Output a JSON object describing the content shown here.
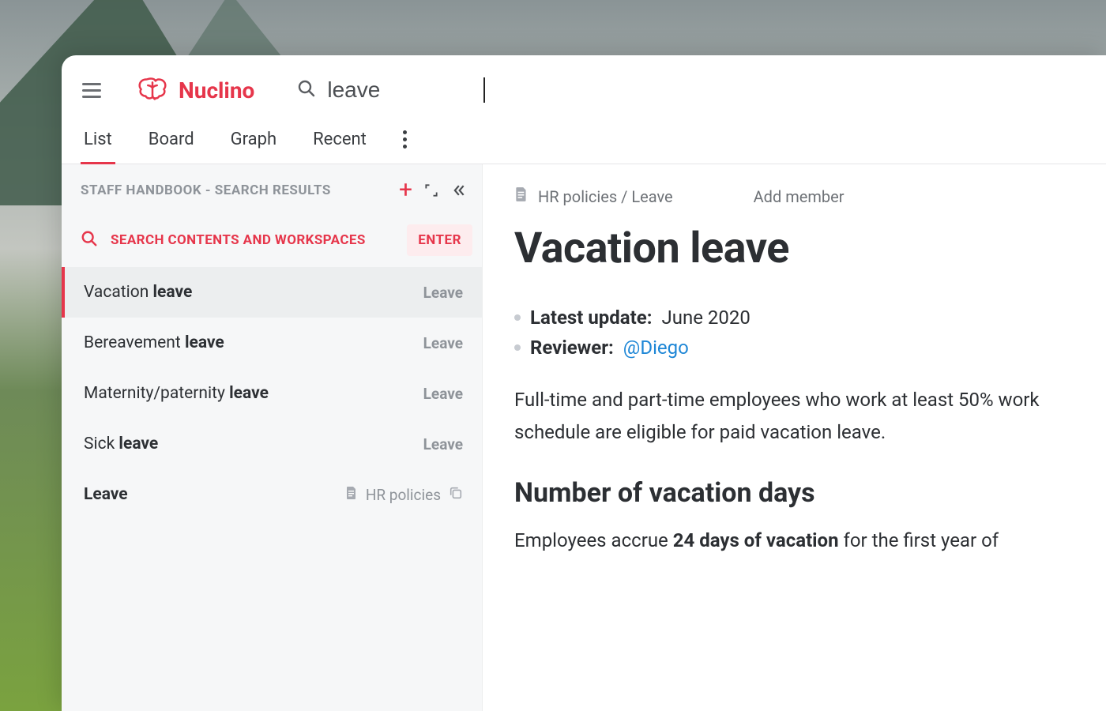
{
  "brand": {
    "name": "Nuclino"
  },
  "search": {
    "value": "leave"
  },
  "tabs": {
    "items": [
      {
        "label": "List",
        "active": true
      },
      {
        "label": "Board",
        "active": false
      },
      {
        "label": "Graph",
        "active": false
      },
      {
        "label": "Recent",
        "active": false
      }
    ]
  },
  "sidebar": {
    "header": "STAFF HANDBOOK - SEARCH RESULTS",
    "search_banner": {
      "text": "SEARCH CONTENTS AND WORKSPACES",
      "hint": "ENTER"
    },
    "results": [
      {
        "prefix": "Vacation ",
        "match": "leave",
        "category": "Leave",
        "active": true
      },
      {
        "prefix": "Bereavement ",
        "match": "leave",
        "category": "Leave",
        "active": false
      },
      {
        "prefix": "Maternity/paternity ",
        "match": "leave",
        "category": "Leave",
        "active": false
      },
      {
        "prefix": "Sick ",
        "match": "leave",
        "category": "Leave",
        "active": false
      }
    ],
    "bottom_item": {
      "title": "Leave",
      "category": "HR policies"
    }
  },
  "doc": {
    "breadcrumb": "HR policies / Leave",
    "add_member": "Add member",
    "title": "Vacation leave",
    "meta": {
      "update_label": "Latest update:",
      "update_value": " June 2020",
      "reviewer_label": "Reviewer:",
      "reviewer_mention": "@Diego"
    },
    "intro": "Full-time and part-time employees who work at least 50% work schedule are eligible for paid vacation leave.",
    "section_heading": "Number of vacation days",
    "section_body_prefix": "Employees accrue ",
    "section_body_bold": "24 days of vacation",
    "section_body_suffix": " for the first year of"
  }
}
